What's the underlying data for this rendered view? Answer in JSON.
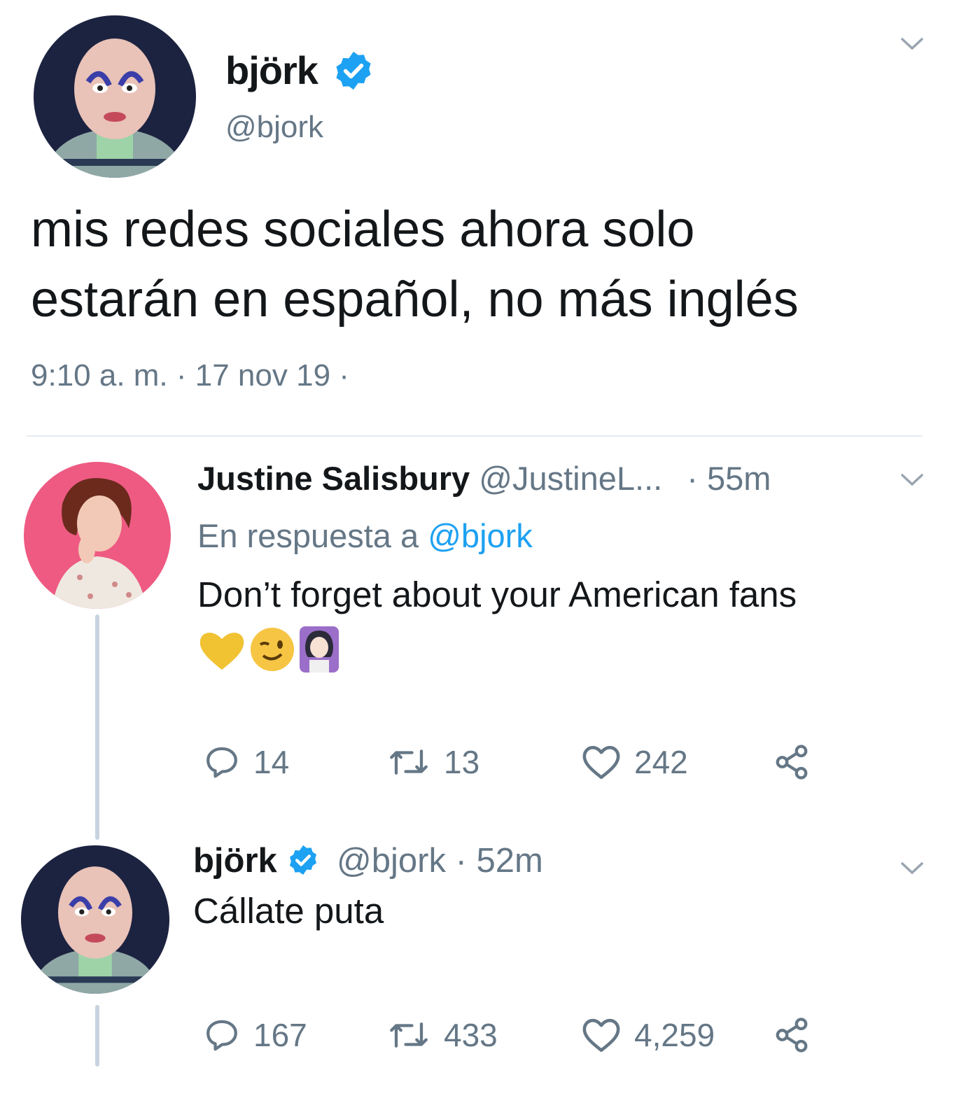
{
  "main_tweet": {
    "display_name": "björk",
    "handle": "@bjork",
    "text_line1": "mis redes sociales ahora solo",
    "text_line2": "estarán en español, no más inglés",
    "timestamp": "9:10 a. m. · 17 nov 19 ·"
  },
  "reply_1": {
    "display_name": "Justine Salisbury",
    "handle": "@JustineL...",
    "time": "· 55m",
    "reply_prefix": "En respuesta a",
    "reply_to": "@bjork",
    "text": "Don’t forget about your American fans",
    "emojis": [
      "yellow-heart",
      "winking-face",
      "woman-gesturing-icon"
    ],
    "stats": {
      "replies": "14",
      "retweets": "13",
      "likes": "242"
    }
  },
  "reply_2": {
    "display_name": "björk",
    "handle": "@bjork",
    "time": "· 52m",
    "text": "Cállate puta",
    "stats": {
      "replies": "167",
      "retweets": "433",
      "likes": "4,259"
    }
  },
  "colors": {
    "verified": "#1da1f2",
    "secondary_text": "#657786",
    "link": "#1da1f2",
    "avatar_pink": "#ee5a82",
    "avatar_dark": "#1c2340"
  }
}
